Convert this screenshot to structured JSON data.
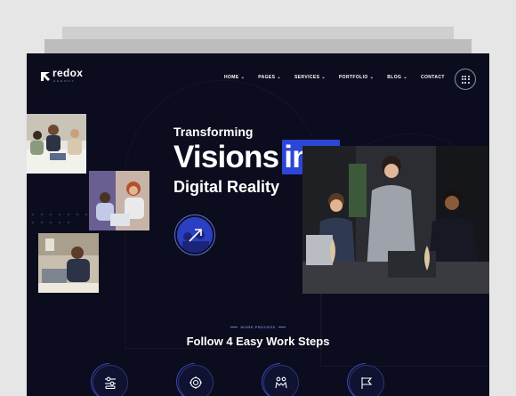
{
  "brand": {
    "name": "redox",
    "sub": "AGENCY"
  },
  "nav": [
    {
      "label": "HOME",
      "caret": "⌄"
    },
    {
      "label": "PAGES",
      "caret": "⌄"
    },
    {
      "label": "SERVICES",
      "caret": "⌄"
    },
    {
      "label": "PORTFOLIO",
      "caret": "⌄"
    },
    {
      "label": "BLOG",
      "caret": "⌄"
    },
    {
      "label": "CONTACT",
      "caret": ""
    }
  ],
  "hero": {
    "line1": "Transforming",
    "line2_plain": "Visions",
    "line2_highlight": "into",
    "line3": "Digital Reality"
  },
  "work_process": {
    "tag": "WORK PROCESS",
    "title": "Follow 4 Easy Work Steps",
    "steps": [
      {
        "icon": "settings-sliders-icon"
      },
      {
        "icon": "target-gear-icon"
      },
      {
        "icon": "team-hands-icon"
      },
      {
        "icon": "flag-icon"
      }
    ]
  },
  "colors": {
    "background": "#0b0d1f",
    "accent": "#2d46d8"
  }
}
